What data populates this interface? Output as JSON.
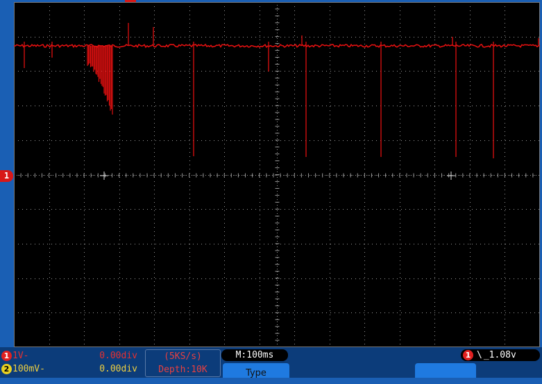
{
  "screen": {
    "trace_color": "#e01010",
    "grid_color": "#9a9a9a",
    "divisions": {
      "x": 15,
      "y": 10
    }
  },
  "ch1_marker": "1",
  "channels": [
    {
      "number": "1",
      "scale": "1V-",
      "position": "0.00div",
      "color": "#e83030"
    },
    {
      "number": "2",
      "scale": "100mV-",
      "position": "0.00div",
      "color": "#f0d040"
    }
  ],
  "acquisition": {
    "sample_rate": "(5KS/s)",
    "depth": "Depth:10K"
  },
  "timebase": "M:100ms",
  "softkeys": {
    "type_label": "Type"
  },
  "trigger": {
    "source": "1",
    "edge": "\\",
    "level": "_1.08v"
  }
}
